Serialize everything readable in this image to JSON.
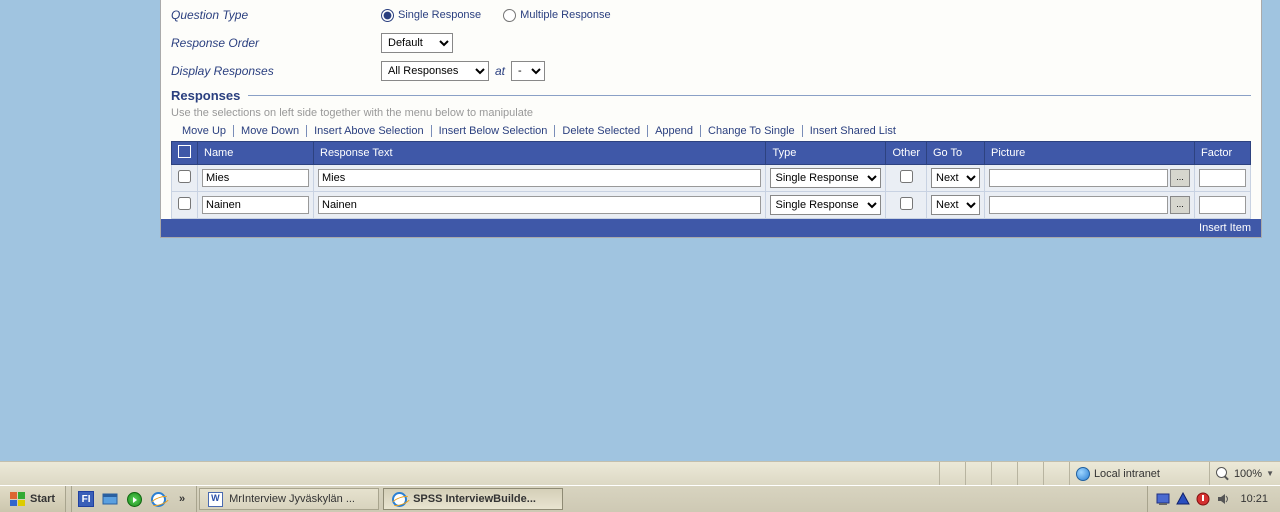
{
  "form": {
    "question_type_label": "Question Type",
    "single_response": "Single Response",
    "multiple_response": "Multiple Response",
    "response_order_label": "Response Order",
    "response_order_value": "Default",
    "display_responses_label": "Display Responses",
    "display_responses_value": "All Responses",
    "at_label": "at",
    "at_value": "-"
  },
  "responses": {
    "title": "Responses",
    "hint": "Use the selections on left side together with the menu below to manipulate",
    "actions": [
      "Move Up",
      "Move Down",
      "Insert Above Selection",
      "Insert Below Selection",
      "Delete Selected",
      "Append",
      "Change To Single",
      "Insert Shared List"
    ],
    "columns": {
      "name": "Name",
      "response_text": "Response Text",
      "type": "Type",
      "other": "Other",
      "goto": "Go To",
      "picture": "Picture",
      "factor": "Factor"
    },
    "rows": [
      {
        "name": "Mies",
        "text": "Mies",
        "type": "Single Response",
        "goto": "Next"
      },
      {
        "name": "Nainen",
        "text": "Nainen",
        "type": "Single Response",
        "goto": "Next"
      }
    ],
    "insert_item": "Insert Item"
  },
  "ie_status": {
    "zone": "Local intranet",
    "zoom": "100%"
  },
  "taskbar": {
    "start": "Start",
    "lang": "FI",
    "items": [
      {
        "label": "MrInterview Jyväskylän ...",
        "icon": "doc"
      },
      {
        "label": "SPSS InterviewBuilde...",
        "icon": "ie",
        "active": true
      }
    ],
    "clock": "10:21"
  }
}
